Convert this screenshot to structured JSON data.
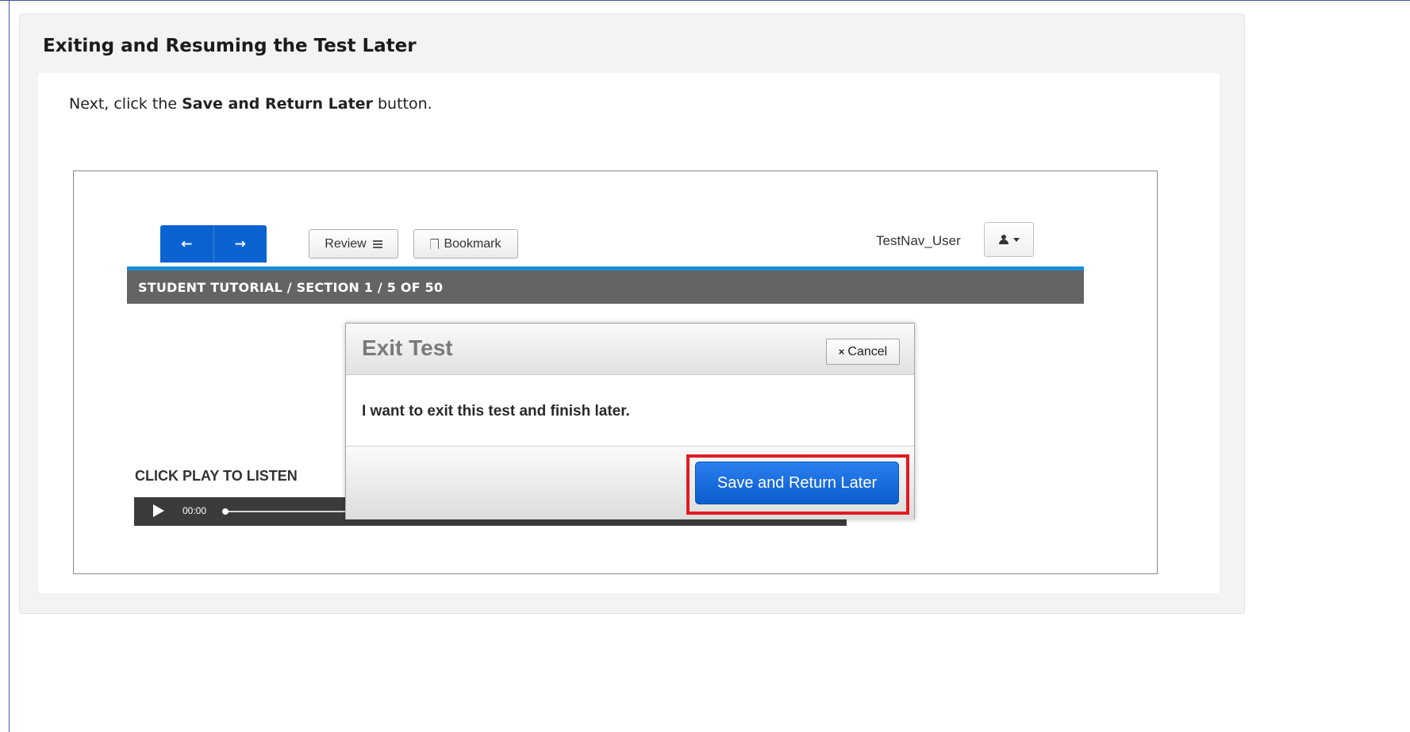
{
  "panel": {
    "title": "Exiting and Resuming the Test Later"
  },
  "instruction": {
    "prefix": "Next, click the ",
    "emphasis": "Save and Return Later",
    "suffix": " button."
  },
  "testnav": {
    "nav_prev_icon": "arrow-left-icon",
    "nav_next_icon": "arrow-right-icon",
    "nav_prev_glyph": "←",
    "nav_next_glyph": "→",
    "review_label": "Review",
    "bookmark_label": "Bookmark",
    "username": "TestNav_User",
    "breadcrumb": "STUDENT TUTORIAL  /  SECTION 1  / 5 OF 50",
    "listen_label": "CLICK PLAY TO LISTEN",
    "audio_time": "00:00",
    "accent_color": "#0a63d0",
    "rule_color": "#1a8fd8"
  },
  "dialog": {
    "title": "Exit Test",
    "cancel_label": "Cancel",
    "message": "I want to exit this test and finish later.",
    "save_label": "Save and Return Later",
    "highlight_color": "#e11b22"
  }
}
